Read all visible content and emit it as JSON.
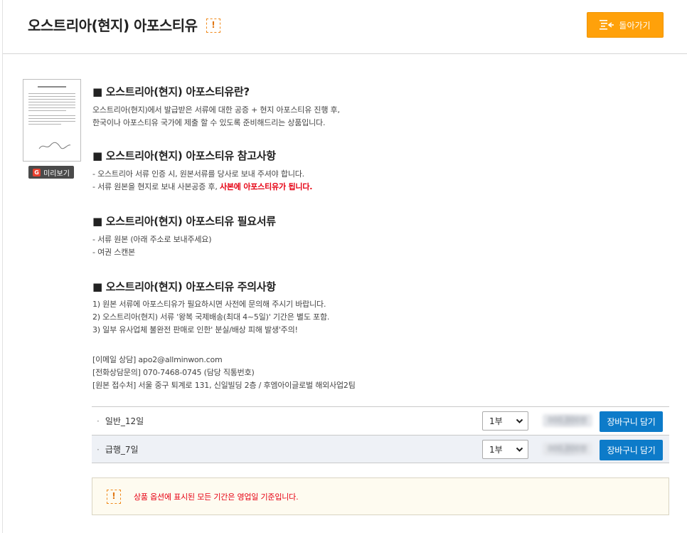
{
  "header": {
    "title": "오스트리아(현지) 아포스티유",
    "alert_icon": "!",
    "back_label": "돌아가기"
  },
  "thumbnail": {
    "preview_label": "미리보기",
    "preview_icon": "G"
  },
  "sections": [
    {
      "heading": "■ 오스트리아(현지) 아포스티유란?",
      "lines": [
        "오스트리아(현지)에서 발급받은 서류에 대한 공증 + 현지 아포스티유 진행 후,",
        "한국이나 아포스티유 국가에 제출 할 수 있도록 준비해드리는 상품입니다."
      ]
    },
    {
      "heading": "■ 오스트리아(현지) 아포스티유 참고사항",
      "lines": [
        "- 오스트리아 서류 인증 시, 원본서류를 당사로 보내 주셔야 합니다."
      ],
      "line2_prefix": "- 서류 원본을 현지로 보내 사본공증 후, ",
      "line2_emph": "사본에 아포스티유가 됩니다."
    },
    {
      "heading": "■ 오스트리아(현지) 아포스티유 필요서류",
      "lines": [
        "- 서류 원본 (아래 주소로 보내주세요)",
        "- 여권 스캔본"
      ]
    },
    {
      "heading": "■ 오스트리아(현지) 아포스티유 주의사항",
      "lines": [
        "1) 원본 서류에 아포스티유가 필요하시면 사전에 문의해 주시기 바랍니다.",
        "2) 오스트리아(현지) 서류 '왕복 국제배송(최대 4~5일)' 기간은 별도 포함.",
        "3) 일부 유사업체 불완전 판매로 인한' 분실/배상 피해 발생'주의!"
      ]
    }
  ],
  "contact": {
    "email": "[이메일 상담] apo2@allminwon.com",
    "phone": "[전화상담문의] 070-7468-0745 (담당 직통번호)",
    "address": "[원본 접수처] 서울 중구 퇴계로 131, 신일빌딩 2층 / 후엠아이글로벌 해외사업2팀"
  },
  "options": [
    {
      "bullet": "·",
      "label": "일반_12일",
      "qty": "1부",
      "price": "000,000원",
      "cart_label": "장바구니 담기"
    },
    {
      "bullet": "·",
      "label": "급행_7일",
      "qty": "1부",
      "price": "000,000원",
      "cart_label": "장바구니 담기"
    }
  ],
  "notice": {
    "icon": "!",
    "text": "상품 옵션에 표시된 모든 기간은 영업일 기준입니다."
  },
  "colors": {
    "accent_orange": "#ffa10a",
    "cart_blue": "#0d7bc9",
    "warning_red": "#e60012"
  }
}
